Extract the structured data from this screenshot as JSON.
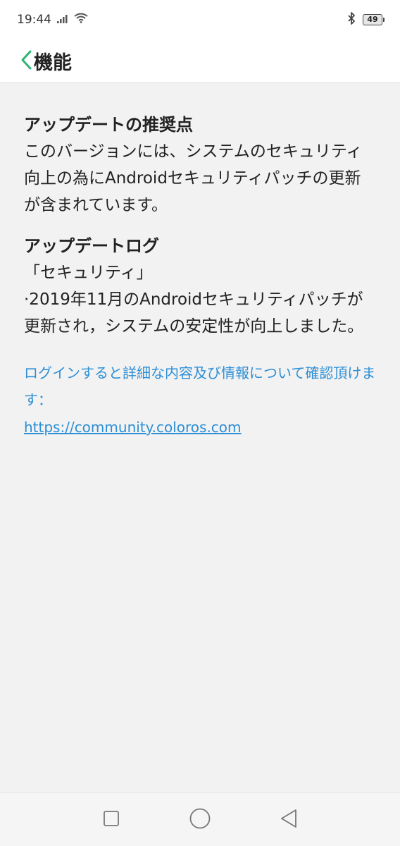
{
  "status": {
    "time": "19:44",
    "battery": "49",
    "icons": [
      "signal-icon",
      "wifi-icon",
      "bluetooth-icon",
      "battery-icon"
    ]
  },
  "header": {
    "title": "機能",
    "accent_color": "#2bb673"
  },
  "recommend": {
    "title": "アップデートの推奨点",
    "body": "このバージョンには、システムのセキュリティ向上の為にAndroidセキュリティパッチの更新が含まれています。"
  },
  "log": {
    "title": "アップデートログ",
    "category": "「セキュリティ」",
    "entry": "·2019年11月のAndroidセキュリティパッチが更新され，システムの安定性が向上しました。"
  },
  "more": {
    "text": "ログインすると詳細な内容及び情報について確認頂けます：",
    "url": "https://community.coloros.com",
    "link_color": "#2d8fd6"
  },
  "nav": {
    "icons": [
      "recent-apps-icon",
      "home-icon",
      "back-icon"
    ]
  }
}
